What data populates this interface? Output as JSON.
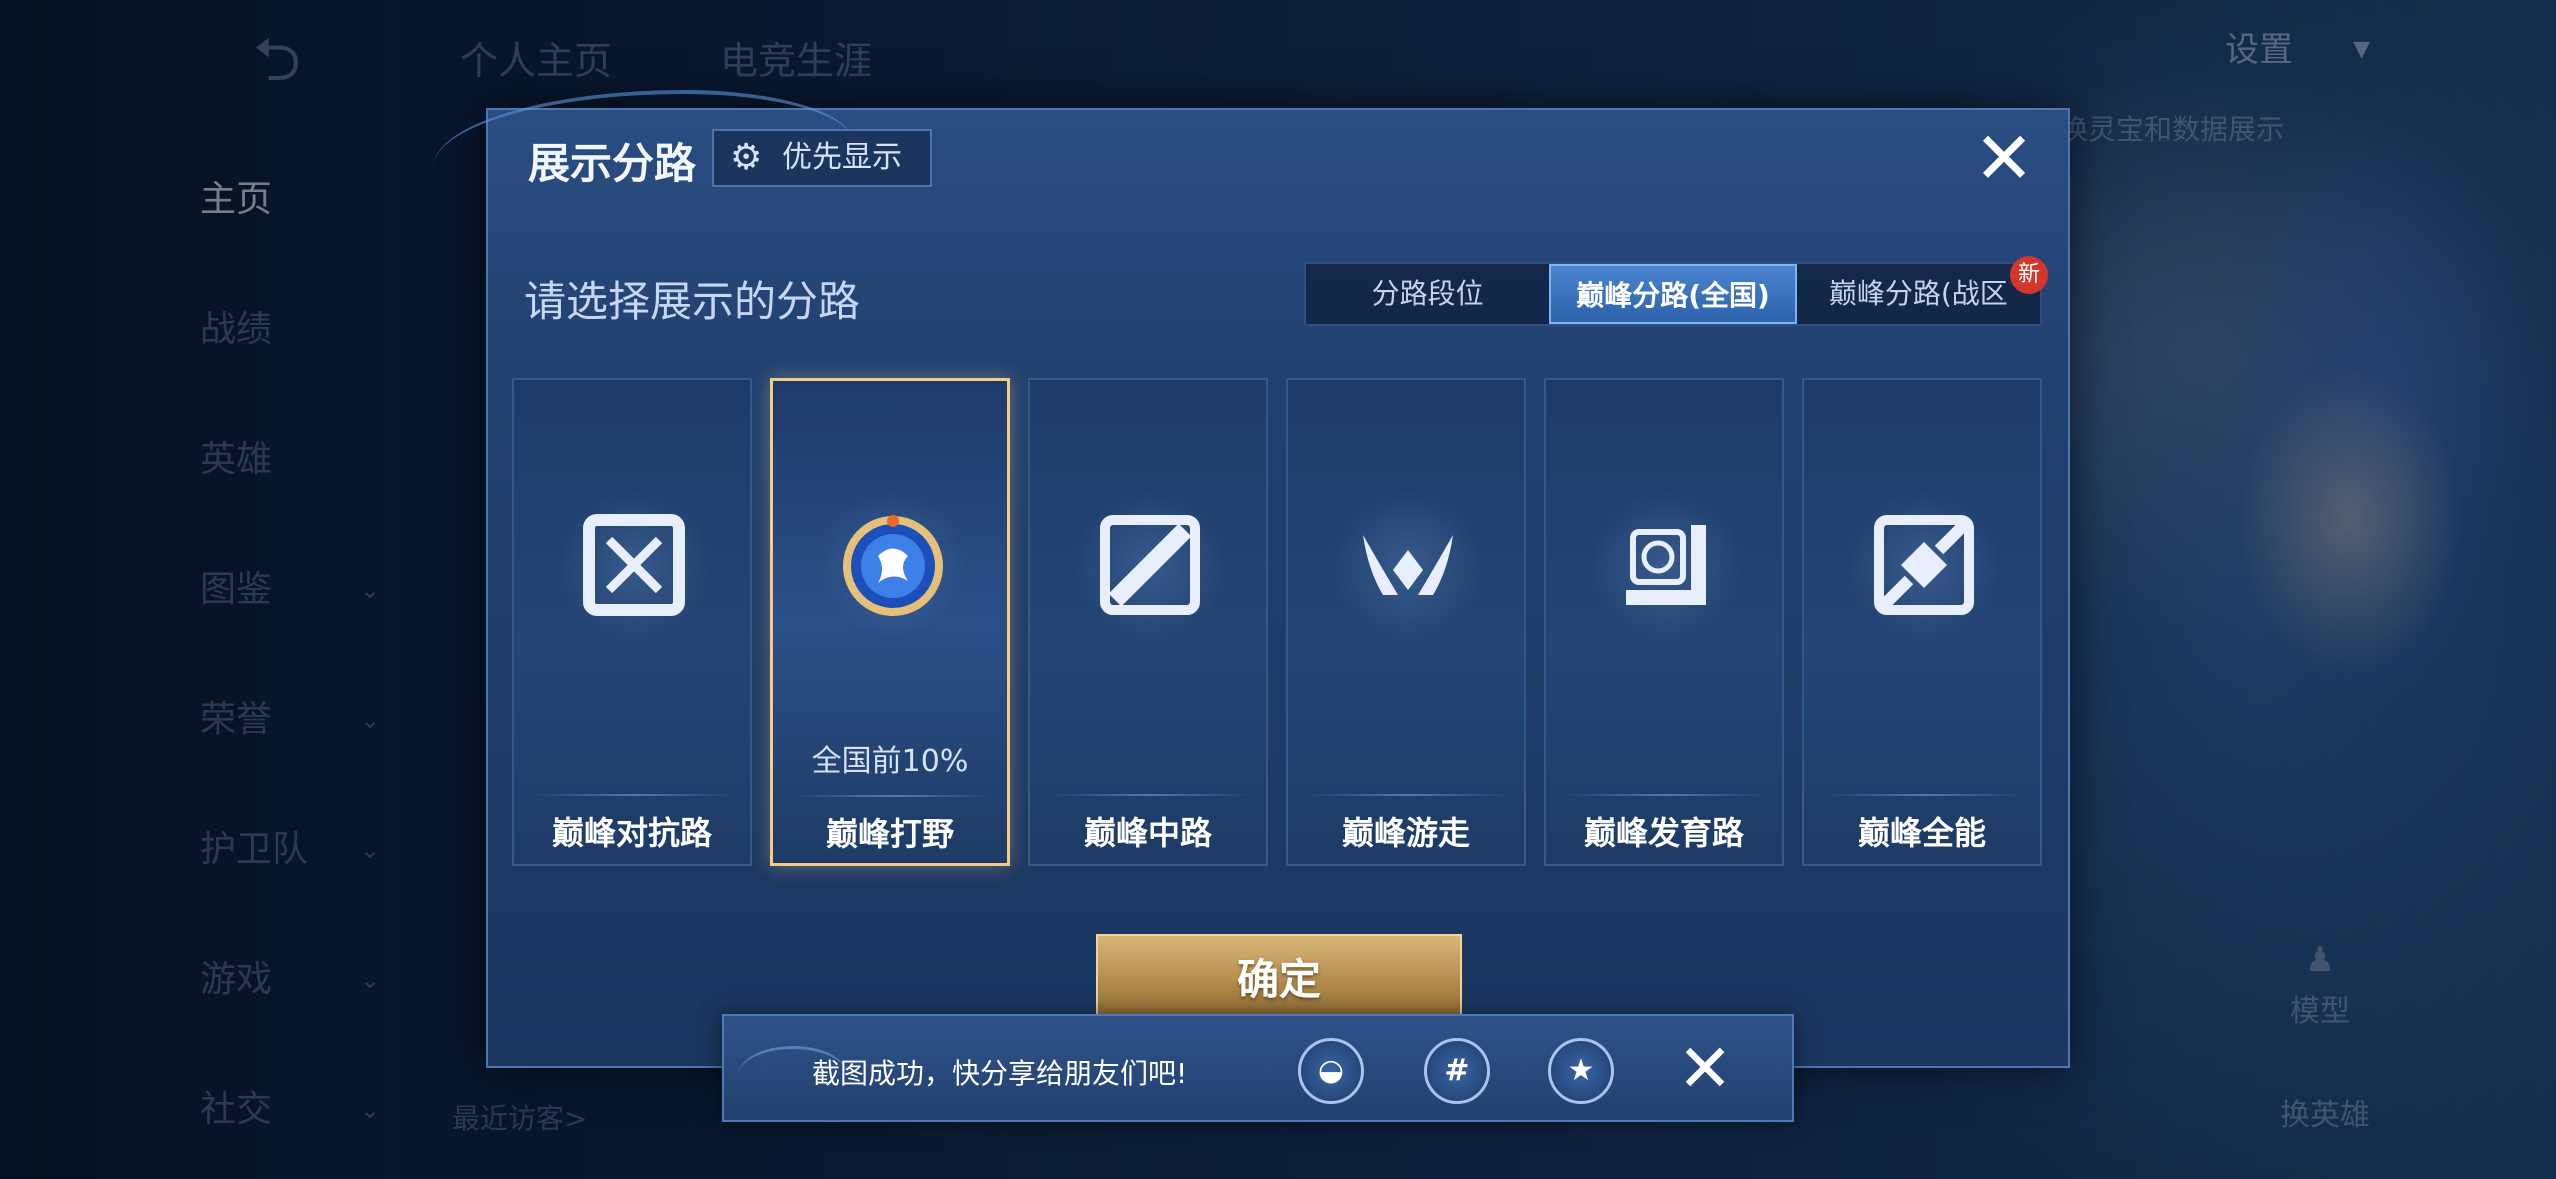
{
  "background": {
    "back_glyph": "⮌",
    "nav": [
      {
        "label": "主页",
        "active": true,
        "chevron": false
      },
      {
        "label": "战绩",
        "active": false,
        "chevron": false
      },
      {
        "label": "英雄",
        "active": false,
        "chevron": false
      },
      {
        "label": "图鉴",
        "active": false,
        "chevron": true
      },
      {
        "label": "荣誉",
        "active": false,
        "chevron": true
      },
      {
        "label": "护卫队",
        "active": false,
        "chevron": true
      },
      {
        "label": "游戏",
        "active": false,
        "chevron": true
      },
      {
        "label": "社交",
        "active": false,
        "chevron": true
      }
    ],
    "chevron_glyph": "⌄",
    "top_tabs": [
      "个人主页",
      "电竞生涯"
    ],
    "settings_label": "设置",
    "banner_text": "换灵宝和数据展示",
    "model_label": "模型",
    "switch_hero_label": "换英雄",
    "visitors_label": "最近访客>"
  },
  "modal": {
    "title": "展示分路",
    "priority_button": "优先显示",
    "gear_icon": "gear-icon",
    "close_glyph": "✕",
    "subtitle": "请选择展示的分路",
    "segment_tabs": [
      {
        "label": "分路段位",
        "active": false,
        "badge": ""
      },
      {
        "label": "巅峰分路(全国)",
        "active": true,
        "badge": ""
      },
      {
        "label": "巅峰分路(战区",
        "active": false,
        "badge": "新"
      }
    ],
    "cards": [
      {
        "label": "巅峰对抗路",
        "rank": "",
        "selected": false,
        "icon": "clash-lane-icon"
      },
      {
        "label": "巅峰打野",
        "rank": "全国前10%",
        "selected": true,
        "icon": "jungle-medal-icon"
      },
      {
        "label": "巅峰中路",
        "rank": "",
        "selected": false,
        "icon": "mid-lane-icon"
      },
      {
        "label": "巅峰游走",
        "rank": "",
        "selected": false,
        "icon": "roam-icon"
      },
      {
        "label": "巅峰发育路",
        "rank": "",
        "selected": false,
        "icon": "farm-lane-icon"
      },
      {
        "label": "巅峰全能",
        "rank": "",
        "selected": false,
        "icon": "all-round-icon"
      }
    ],
    "confirm_label": "确定"
  },
  "toast": {
    "text": "截图成功，快分享给朋友们吧!",
    "share_icons": [
      {
        "name": "qq-share-icon",
        "glyph": "◒"
      },
      {
        "name": "wechat-moments-share-icon",
        "glyph": "#"
      },
      {
        "name": "qzone-share-icon",
        "glyph": "★"
      }
    ],
    "close_glyph": "✕"
  },
  "colors": {
    "accent_gold": "#f2cc86",
    "active_tab": "#3f78c4",
    "badge_red": "#d2372c",
    "confirm_gold": "#c29b5a"
  }
}
